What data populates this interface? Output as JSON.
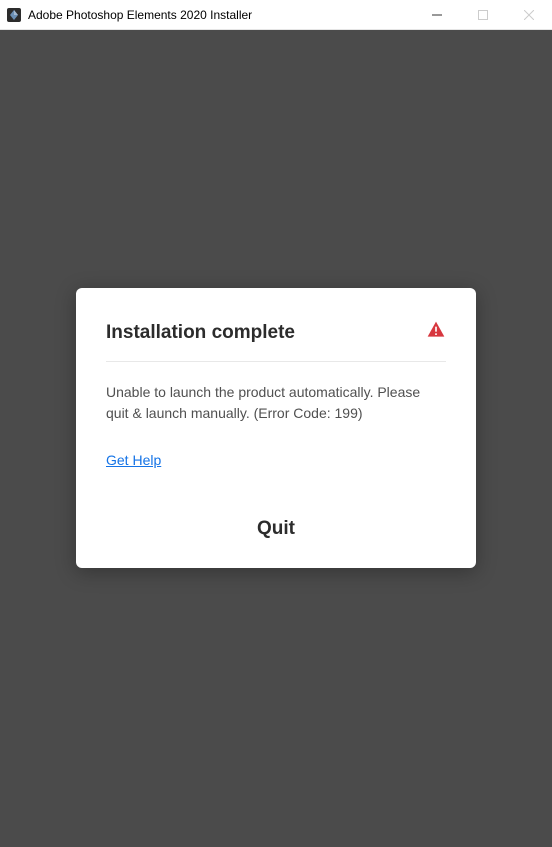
{
  "titlebar": {
    "title": "Adobe Photoshop Elements 2020 Installer"
  },
  "dialog": {
    "title": "Installation complete",
    "message": "Unable to launch the product automatically. Please quit & launch manually. (Error Code: 199)",
    "help_link": "Get Help",
    "quit_label": "Quit"
  }
}
